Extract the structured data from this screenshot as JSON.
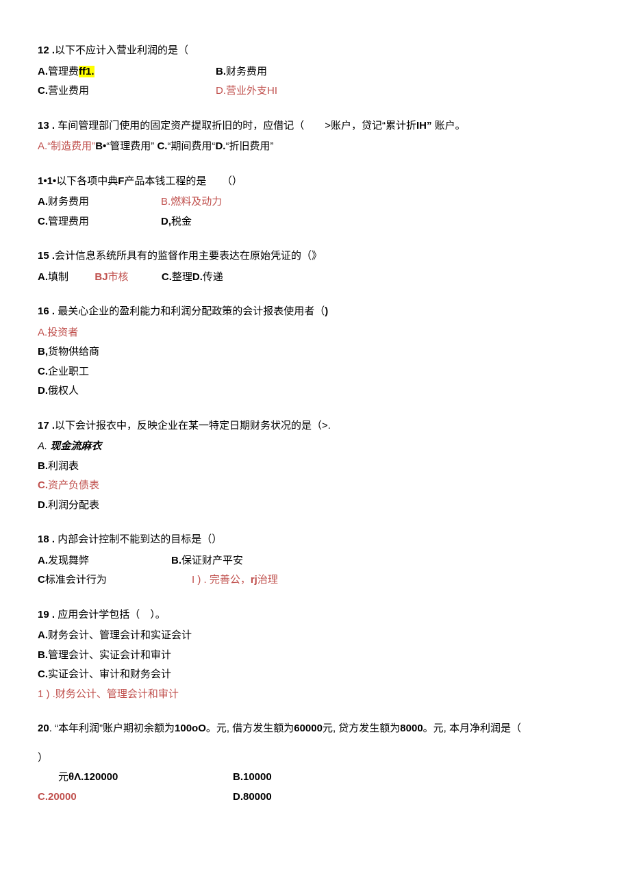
{
  "q12": {
    "num": "12",
    "dot": " .",
    "text": "以下不应计入营业利润的是（",
    "A_pre": "A.",
    "A_mid": "管理费",
    "A_hl": "ff1.",
    "B_pre": "B.",
    "B_txt": "财务费用",
    "C_pre": "C.",
    "C_txt": "营业费用",
    "D_pre": "D.",
    "D_txt": "营业外支HI"
  },
  "q13": {
    "num": "13",
    "dot": " .",
    "text": " 车间管理部门使用的固定资产提取折旧的时，应借记（　　>账户，贷记“累计折",
    "tail_b": "IH”",
    "tail2": " 账户。",
    "A_pre": "A.",
    "A_txt": "“制造费用”",
    "B_pre": "B•",
    "B_txt": "“管理费用” ",
    "C_pre": "C.",
    "C_txt": "“期间费用“",
    "D_pre": "D.",
    "D_txt": "“折旧费用”"
  },
  "q14": {
    "num": "1•1•",
    "text": "以下各项中典",
    "mid_b": "F",
    "mid2": "产品本钱工程的是　　（）",
    "A_pre": "A.",
    "A_txt": "财务费用",
    "B_pre": "B.",
    "B_txt": "燃料及动力",
    "C_pre": "C.",
    "C_txt": "管理费用",
    "D_pre": "D,",
    "D_txt": "税金"
  },
  "q15": {
    "num": "15",
    "dot": " .",
    "text": "会计信息系统所具有的监督作用主要表达在原始凭证的（》",
    "A_pre": "A.",
    "A_txt": "填制",
    "B_pre": "BJ",
    "B_txt": "市核",
    "C_pre": "C.",
    "C_txt": "整理",
    "D_pre": "D.",
    "D_txt": "传递"
  },
  "q16": {
    "num": "16",
    "dot": " .",
    "text": " 最关心企业的盈利能力和利润分配政策的会计报表使用者（",
    "tail_b": ")",
    "A_pre": "A.",
    "A_txt": "投资者",
    "B_pre": "B,",
    "B_txt": "货物供给商",
    "C_pre": "C.",
    "C_txt": "企业职工",
    "D_pre": "D.",
    "D_txt": "俄权人"
  },
  "q17": {
    "num": "17",
    "dot": " .",
    "text": "以下会计报衣中，反映企业在某一特定日期财务状况的是（>.",
    "A_pre": "A. ",
    "A_txt": "现金流麻衣",
    "B_pre": "B.",
    "B_txt": "利润表",
    "C_pre": "C.",
    "C_txt": "资产负债表",
    "D_pre": "D.",
    "D_txt": "利润分配表"
  },
  "q18": {
    "num": "18",
    "dot": " .",
    "text": " 内部会计控制不能到达的目标是（）",
    "A_pre": "A.",
    "A_txt": "发现舞弊",
    "B_pre": "B.",
    "B_txt": "保证财产平安",
    "C_pre": "C",
    "C_txt": "标准会计行为",
    "D_pre": "I ) .",
    "D_txt1": " 完善公，",
    "D_b": "rj",
    "D_txt2": "治理"
  },
  "q19": {
    "num": "19",
    "dot": " .",
    "text": " 应用会计学包括（ ）。",
    "A_pre": "A.",
    "A_txt": "财务会计、管理会计和实证会计",
    "B_pre": "B.",
    "B_txt": "管理会计、实证会计和审计",
    "C_pre": "C.",
    "C_txt": "实证会计、审计和财务会计",
    "D_pre": "1 ) .",
    "D_txt": "财务公计、管理会计和审计"
  },
  "q20": {
    "num": "20",
    "dot": ".",
    "t1": " “本年利润”账户期初余额为",
    "b1": "100oO",
    "t2": "。元, 借方发生额为",
    "b2": "60000",
    "t3": "元, 贷方发生额为",
    "b3": "8000",
    "t4": "。元, 本月净利润是（",
    "paren": "）",
    "A_pre": "元",
    "A_b": "θΛ.120000",
    "B_pre": "B.10000",
    "C_pre": "C.20000",
    "D_pre": "D.80000"
  }
}
